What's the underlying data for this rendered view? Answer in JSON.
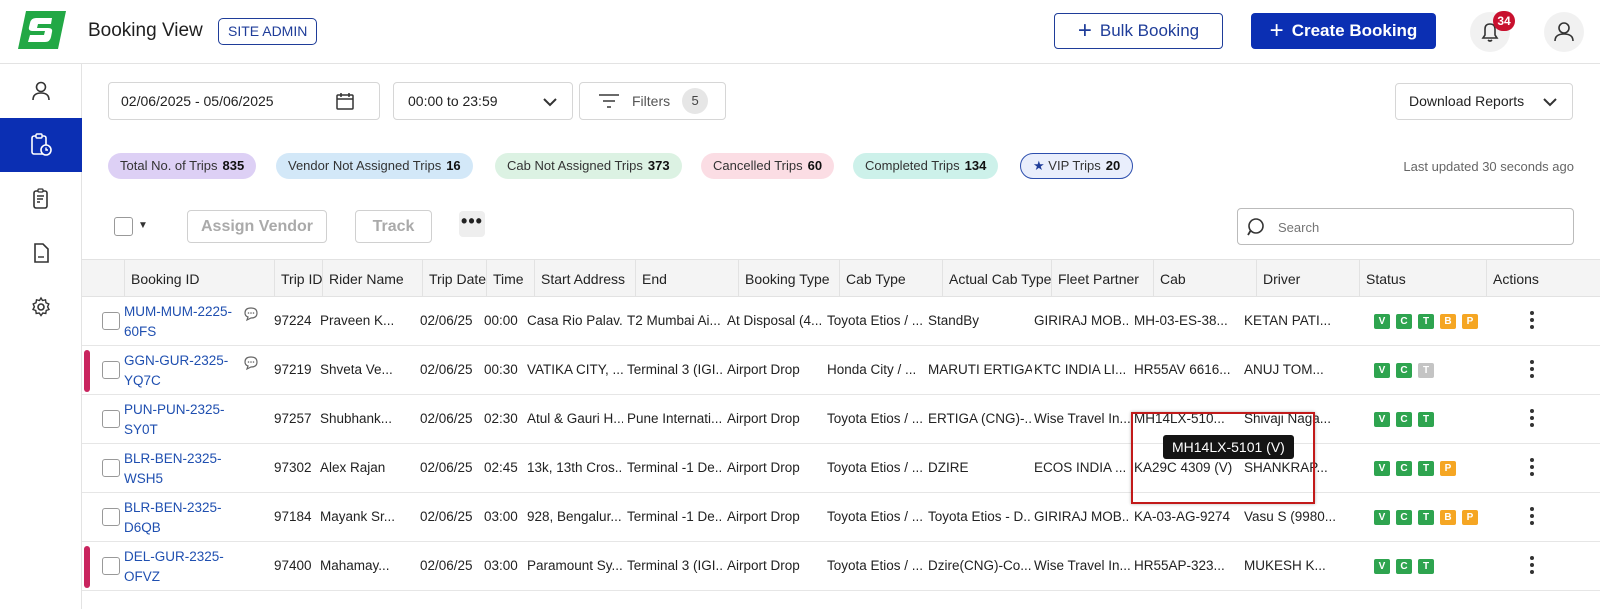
{
  "header": {
    "title": "Booking View",
    "role_badge": "SITE ADMIN",
    "bulk_booking_label": "Bulk Booking",
    "create_booking_label": "Create Booking",
    "notification_count": "34"
  },
  "toolbar": {
    "date_range": "02/06/2025 - 05/06/2025",
    "time_range": "00:00 to 23:59",
    "filters_label": "Filters",
    "filters_count": "5",
    "download_label": "Download Reports"
  },
  "summary": [
    {
      "label": "Total No. of Trips",
      "count": "835",
      "color": "#ddd0f5"
    },
    {
      "label": "Vendor Not Assigned Trips",
      "count": "16",
      "color": "#d3e8f8"
    },
    {
      "label": "Cab Not Assigned Trips",
      "count": "373",
      "color": "#dcf2e3"
    },
    {
      "label": "Cancelled Trips",
      "count": "60",
      "color": "#fbdde4"
    },
    {
      "label": "Completed Trips",
      "count": "134",
      "color": "#cdf1ea"
    },
    {
      "label": "VIP Trips",
      "count": "20",
      "color": "#e9eefc"
    }
  ],
  "last_updated": "Last updated 30 seconds ago",
  "actions": {
    "assign_vendor": "Assign Vendor",
    "track": "Track",
    "more": "•••",
    "search_placeholder": "Search"
  },
  "table": {
    "columns": [
      "Booking ID",
      "Trip ID",
      "Rider Name",
      "Trip Date",
      "Time",
      "Start Address",
      "End",
      "Booking Type",
      "Cab Type",
      "Actual Cab Type",
      "Fleet Partner",
      "Cab",
      "Driver",
      "Status",
      "Actions"
    ],
    "rows": [
      {
        "booking_id": "MUM-MUM-2225-60FS",
        "trip_id": "97224",
        "rider": "Praveen K...",
        "date": "02/06/25",
        "time": "00:00",
        "start": "Casa Rio Palav...",
        "end": "T2 Mumbai Ai...",
        "booking_type": "At Disposal (4...",
        "cab_type": "Toyota Etios / ...",
        "actual_cab": "StandBy",
        "fleet": "GIRIRAJ MOB...",
        "cab": "MH-03-ES-38...",
        "driver": "KETAN PATI...",
        "status": [
          "V",
          "C",
          "T",
          "B",
          "P"
        ],
        "marker": false,
        "chat": true
      },
      {
        "booking_id": "GGN-GUR-2325-YQ7C",
        "trip_id": "97219",
        "rider": "Shveta Ve...",
        "date": "02/06/25",
        "time": "00:30",
        "start": "VATIKA CITY, ...",
        "end": "Terminal 3 (IGI...",
        "booking_type": "Airport Drop",
        "cab_type": "Honda City / ...",
        "actual_cab": "MARUTI ERTIGA",
        "fleet": "KTC INDIA LI...",
        "cab": "HR55AV 6616...",
        "driver": "ANUJ TOM...",
        "status": [
          "V",
          "C",
          "T"
        ],
        "marker": true,
        "chat": true
      },
      {
        "booking_id": "PUN-PUN-2325-SY0T",
        "trip_id": "97257",
        "rider": "Shubhank...",
        "date": "02/06/25",
        "time": "02:30",
        "start": "Atul & Gauri H...",
        "end": "Pune Internati...",
        "booking_type": "Airport Drop",
        "cab_type": "Toyota Etios / ...",
        "actual_cab": "ERTIGA (CNG)-...",
        "fleet": "Wise Travel In...",
        "cab": "MH14LX-510...",
        "driver": "Shivaji Naga...",
        "status": [
          "V",
          "C",
          "T"
        ],
        "marker": false,
        "chat": false
      },
      {
        "booking_id": "BLR-BEN-2325-WSH5",
        "trip_id": "97302",
        "rider": "Alex Rajan",
        "date": "02/06/25",
        "time": "02:45",
        "start": "13k, 13th Cros...",
        "end": "Terminal -1 De...",
        "booking_type": "Airport Drop",
        "cab_type": "Toyota Etios / ...",
        "actual_cab": "DZIRE",
        "fleet": "ECOS INDIA ...",
        "cab": "KA29C 4309 (V)",
        "driver": "SHANKRAP...",
        "status": [
          "V",
          "C",
          "T",
          "P"
        ],
        "marker": false,
        "chat": false
      },
      {
        "booking_id": "BLR-BEN-2325-D6QB",
        "trip_id": "97184",
        "rider": "Mayank Sr...",
        "date": "02/06/25",
        "time": "03:00",
        "start": "928, Bengalur...",
        "end": "Terminal -1 De...",
        "booking_type": "Airport Drop",
        "cab_type": "Toyota Etios / ...",
        "actual_cab": "Toyota Etios - D...",
        "fleet": "GIRIRAJ MOB...",
        "cab": "KA-03-AG-9274",
        "driver": "Vasu S (9980...",
        "status": [
          "V",
          "C",
          "T",
          "B",
          "P"
        ],
        "marker": false,
        "chat": false
      },
      {
        "booking_id": "DEL-GUR-2325-OFVZ",
        "trip_id": "97400",
        "rider": "Mahamay...",
        "date": "02/06/25",
        "time": "03:00",
        "start": "Paramount Sy...",
        "end": "Terminal 3 (IGI...",
        "booking_type": "Airport Drop",
        "cab_type": "Toyota Etios / ...",
        "actual_cab": "Dzire(CNG)-Co...",
        "fleet": "Wise Travel In...",
        "cab": "HR55AP-323...",
        "driver": "MUKESH K...",
        "status": [
          "V",
          "C",
          "T"
        ],
        "marker": true,
        "chat": false
      }
    ]
  },
  "tooltip": "MH14LX-5101 (V)"
}
